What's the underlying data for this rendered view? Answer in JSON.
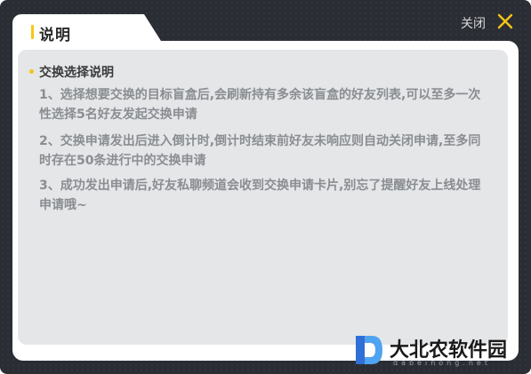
{
  "dialog": {
    "title": "说明",
    "close_label": "关闭"
  },
  "content": {
    "section_title": "交换选择说明",
    "items": [
      "1、选择想要交换的目标盲盒后,会刷新持有多余该盲盒的好友列表,可以至多一次性选择5名好友发起交换申请",
      "2、交换申请发出后进入倒计时,倒计时结束前好友未响应则自动关闭申请,至多同时存在50条进行中的交换申请",
      "3、成功发出申请后,好友私聊频道会收到交换申请卡片,别忘了提醒好友上线处理申请哦~"
    ]
  },
  "watermark": {
    "text": "大北农软件园",
    "sub": "dabeinong.net"
  },
  "colors": {
    "accent": "#f5c518",
    "frame": "#2a2d34",
    "panel": "#e4e6e8",
    "body_text": "#8a8d91"
  },
  "icons": {
    "close": "close-icon",
    "watermark_logo": "logo-icon"
  }
}
